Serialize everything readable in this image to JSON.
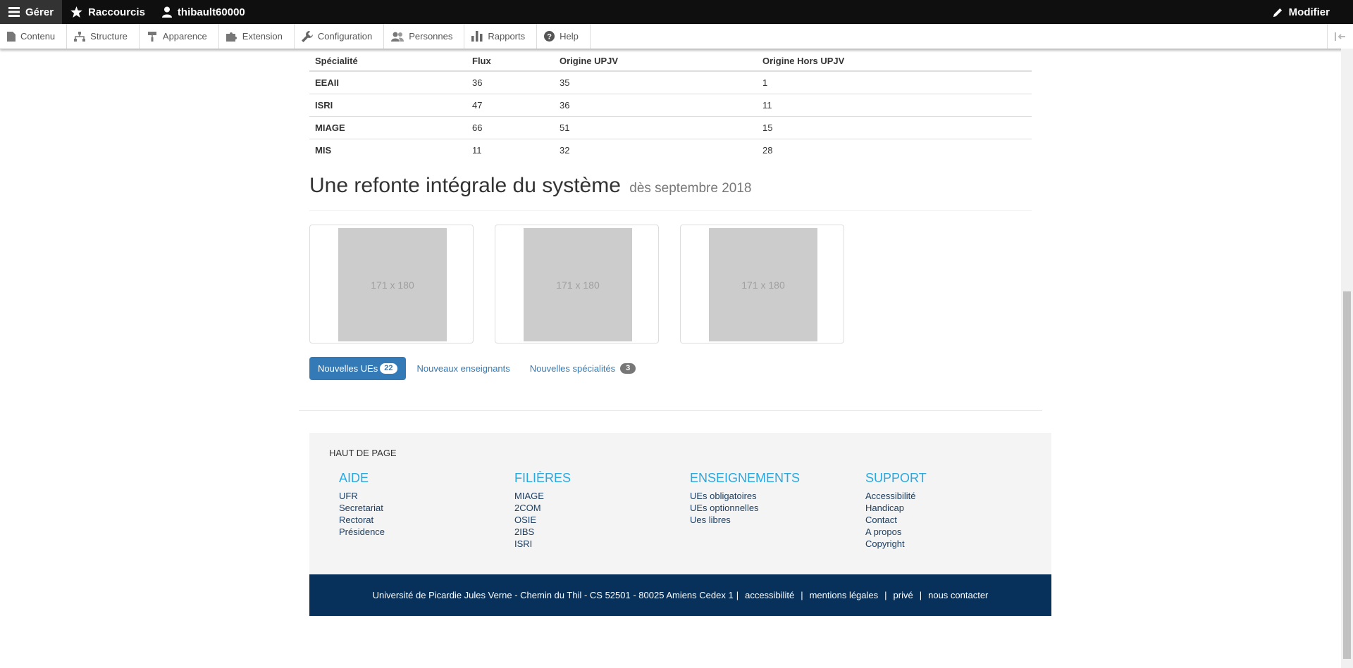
{
  "toolbar": {
    "manage": "Gérer",
    "shortcuts": "Raccourcis",
    "user": "thibault60000",
    "edit": "Modifier"
  },
  "tray": {
    "items": [
      "Contenu",
      "Structure",
      "Apparence",
      "Extension",
      "Configuration",
      "Personnes",
      "Rapports",
      "Help"
    ]
  },
  "table": {
    "headers": [
      "Spécialité",
      "Flux",
      "Origine UPJV",
      "Origine Hors UPJV"
    ],
    "rows": [
      [
        "EEAII",
        "36",
        "35",
        "1"
      ],
      [
        "ISRI",
        "47",
        "36",
        "11"
      ],
      [
        "MIAGE",
        "66",
        "51",
        "15"
      ],
      [
        "MIS",
        "11",
        "32",
        "28"
      ]
    ]
  },
  "section": {
    "title": "Une refonte intégrale du système",
    "subtitle": "dès septembre 2018"
  },
  "thumbnails": [
    "171 x 180",
    "171 x 180",
    "171 x 180"
  ],
  "pills": [
    {
      "label": "Nouvelles UEs",
      "badge": "22"
    },
    {
      "label": "Nouveaux enseignants"
    },
    {
      "label": "Nouvelles spécialités",
      "badge": "3"
    }
  ],
  "footer": {
    "back_to_top": "HAUT DE PAGE",
    "columns": [
      {
        "title": "AIDE",
        "links": [
          "UFR",
          "Secretariat",
          "Rectorat",
          "Présidence"
        ]
      },
      {
        "title": "FILIÈRES",
        "links": [
          "MIAGE",
          "2COM",
          "OSIE",
          "2IBS",
          "ISRI"
        ]
      },
      {
        "title": "ENSEIGNEMENTS",
        "links": [
          "UEs obligatoires",
          "UEs optionnelles",
          "Ues libres"
        ]
      },
      {
        "title": "SUPPORT",
        "links": [
          "Accessibilité",
          "Handicap",
          "Contact",
          "A propos",
          "Copyright"
        ]
      }
    ],
    "address": "Université de Picardie Jules Verne - Chemin du Thil - CS 52501 - 80025 Amiens Cedex 1",
    "legal_links": [
      "accessibilité",
      "mentions légales",
      "privé",
      "nous contacter"
    ]
  },
  "colors": {
    "toolbar_bg": "#0f0f0f",
    "primary_blue": "#337ab7",
    "footer_heading": "#29a9e0",
    "footer_bar": "#07305a"
  }
}
